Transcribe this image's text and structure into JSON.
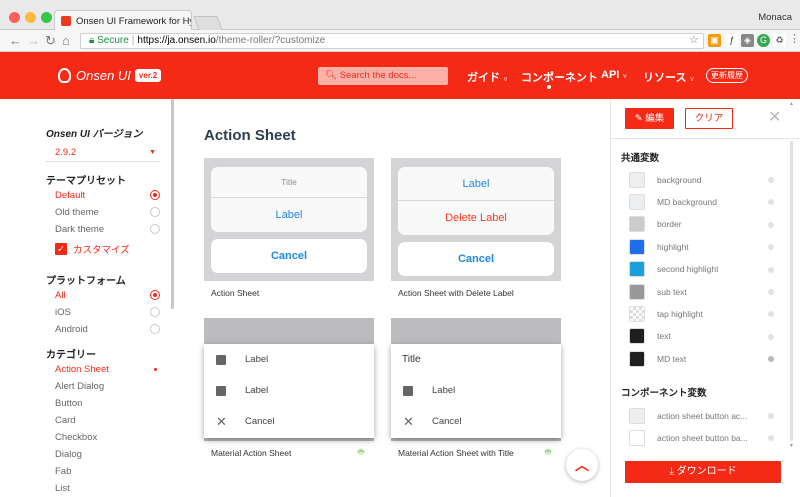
{
  "browser": {
    "tab_title": "Onsen UI Framework for Hybri",
    "profile": "Monaca",
    "secure_label": "Secure",
    "url_host": "https://ja.onsen.io",
    "url_path": "/theme-roller/?customize"
  },
  "header": {
    "logo_text": "Onsen UI",
    "version_badge": "ver.2",
    "search_placeholder": "Search the docs...",
    "nav": [
      {
        "label": "ガイド",
        "caret": "∨"
      },
      {
        "label": "コンポーネント",
        "caret": ""
      },
      {
        "label": "API",
        "caret": "∨"
      },
      {
        "label": "リソース",
        "caret": "∨"
      }
    ],
    "whats_new": "更新履歴"
  },
  "sidebar": {
    "version_heading": "Onsen UI バージョン",
    "version_value": "2.9.2",
    "preset_heading": "テーマプリセット",
    "presets": [
      {
        "label": "Default",
        "active": true
      },
      {
        "label": "Old theme",
        "active": false
      },
      {
        "label": "Dark theme",
        "active": false
      }
    ],
    "customize_label": "カスタマイズ",
    "platform_heading": "プラットフォーム",
    "platforms": [
      {
        "label": "All",
        "active": true
      },
      {
        "label": "iOS",
        "active": false
      },
      {
        "label": "Android",
        "active": false
      }
    ],
    "category_heading": "カテゴリー",
    "categories": [
      "Action Sheet",
      "Alert Dialog",
      "Button",
      "Card",
      "Checkbox",
      "Dialog",
      "Fab",
      "List"
    ]
  },
  "main": {
    "title": "Action Sheet",
    "cards": [
      {
        "caption": "Action Sheet",
        "platform": "ios",
        "sheet_title": "Title",
        "action": "Label",
        "cancel": "Cancel"
      },
      {
        "caption": "Action Sheet with Delete Label",
        "platform": "ios",
        "action": "Label",
        "delete": "Delete Label",
        "cancel": "Cancel"
      },
      {
        "caption": "Material Action Sheet",
        "platform": "android",
        "rows": [
          "Label",
          "Label",
          "Cancel"
        ]
      },
      {
        "caption": "Material Action Sheet with Title",
        "platform": "android",
        "sheet_title": "Title",
        "rows": [
          "Label",
          "Cancel"
        ]
      }
    ]
  },
  "panel": {
    "edit_label": "編集",
    "clear_label": "クリア",
    "common_heading": "共通変数",
    "common_vars": [
      {
        "name": "background",
        "color": "#eeeeee"
      },
      {
        "name": "MD background",
        "color": "#eceff1"
      },
      {
        "name": "border",
        "color": "#cccccc"
      },
      {
        "name": "highlight",
        "color": "#1f6feb"
      },
      {
        "name": "second highlight",
        "color": "#1aa1db"
      },
      {
        "name": "sub text",
        "color": "#999999"
      },
      {
        "name": "tap highlight",
        "color": "checker"
      },
      {
        "name": "text",
        "color": "#1f1f21"
      },
      {
        "name": "MD text",
        "color": "#1f1f21"
      }
    ],
    "component_heading": "コンポーネント変数",
    "component_vars": [
      {
        "name": "action sheet button ac...",
        "color": "#eeeeee"
      },
      {
        "name": "action sheet button ba...",
        "color": "#ffffff"
      }
    ],
    "download_label": "ダウンロード"
  },
  "colors": {
    "brand": "#f42916",
    "ios_blue": "#1e88e5",
    "ios_red": "#fe3824",
    "android_green": "#78c257"
  }
}
